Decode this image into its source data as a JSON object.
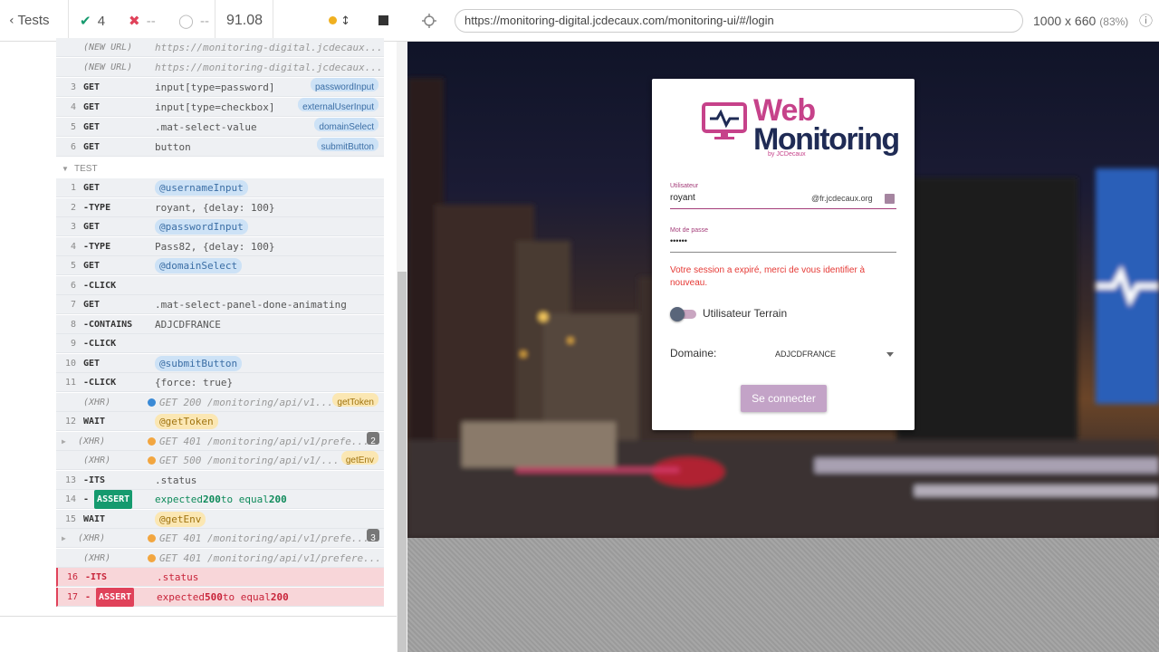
{
  "reporter": {
    "tests_label": "Tests",
    "passed": "4",
    "failed": "--",
    "pending": "--",
    "duration": "91.08",
    "commands_before": [
      {
        "num": "",
        "name": "(NEW URL)",
        "msg": "https://monitoring-digital.jcdecaux...",
        "italic": true
      },
      {
        "num": "",
        "name": "(NEW URL)",
        "msg": "https://monitoring-digital.jcdecaux...",
        "italic": true
      },
      {
        "num": "3",
        "name": "GET",
        "msg": "input[type=password]",
        "alias": "passwordInput"
      },
      {
        "num": "4",
        "name": "GET",
        "msg": "input[type=checkbox]",
        "alias": "externalUserInput"
      },
      {
        "num": "5",
        "name": "GET",
        "msg": ".mat-select-value",
        "alias": "domainSelect"
      },
      {
        "num": "6",
        "name": "GET",
        "msg": "button",
        "alias": "submitButton"
      }
    ],
    "test_label": "TEST",
    "commands": [
      {
        "num": "1",
        "name": "GET",
        "msg": "@usernameInput"
      },
      {
        "num": "2",
        "name": "-TYPE",
        "msg": "royant, {delay: 100}"
      },
      {
        "num": "3",
        "name": "GET",
        "msg": "@passwordInput"
      },
      {
        "num": "4",
        "name": "-TYPE",
        "msg": "Pass82, {delay: 100}"
      },
      {
        "num": "5",
        "name": "GET",
        "msg": "@domainSelect"
      },
      {
        "num": "6",
        "name": "-CLICK",
        "msg": ""
      },
      {
        "num": "7",
        "name": "GET",
        "msg": ".mat-select-panel-done-animating"
      },
      {
        "num": "8",
        "name": "-CONTAINS",
        "msg": "ADJCDFRANCE"
      },
      {
        "num": "9",
        "name": "-CLICK",
        "msg": ""
      },
      {
        "num": "10",
        "name": "GET",
        "msg": "@submitButton"
      },
      {
        "num": "11",
        "name": "-CLICK",
        "msg": "{force: true}"
      },
      {
        "num": "",
        "name": "(XHR)",
        "msg": "GET 200 /monitoring/api/v1...",
        "alias": "getToken"
      },
      {
        "num": "12",
        "name": "WAIT",
        "msg": "@getToken"
      },
      {
        "num": "",
        "name": "(XHR)",
        "msg": "GET 401 /monitoring/api/v1/prefe...",
        "count": "2"
      },
      {
        "num": "",
        "name": "(XHR)",
        "msg": "GET 500 /monitoring/api/v1/...",
        "alias": "getEnv"
      },
      {
        "num": "13",
        "name": "-ITS",
        "msg": ".status"
      },
      {
        "num": "14",
        "name": "-ASSERT",
        "assert_parts": [
          "expected",
          "200",
          "to equal",
          "200"
        ]
      },
      {
        "num": "15",
        "name": "WAIT",
        "msg": "@getEnv"
      },
      {
        "num": "",
        "name": "(XHR)",
        "msg": "GET 401 /monitoring/api/v1/prefe...",
        "count": "3"
      },
      {
        "num": "",
        "name": "(XHR)",
        "msg": "GET 401 /monitoring/api/v1/prefere..."
      },
      {
        "num": "16",
        "name": "-ITS",
        "msg": ".status"
      },
      {
        "num": "17",
        "name": "-ASSERT",
        "assert_parts": [
          "expected",
          "500",
          "to equal",
          "200"
        ]
      }
    ]
  },
  "aut": {
    "url": "https://monitoring-digital.jcdecaux.com/monitoring-ui/#/login",
    "viewport": "1000 x 660",
    "scale": "(83%)"
  },
  "login": {
    "logo_web": "Web",
    "logo_monitoring": "Monitoring",
    "logo_by": "by JCDecaux",
    "user_label": "Utilisateur",
    "user_value": "royant",
    "user_suffix": "@fr.jcdecaux.org",
    "password_label": "Mot de passe",
    "password_value": "••••••",
    "error": "Votre session a expiré, merci de vous identifier à nouveau.",
    "toggle_label": "Utilisateur Terrain",
    "domain_label": "Domaine:",
    "domain_value": "ADJCDFRANCE",
    "submit_label": "Se connecter"
  },
  "colors": {
    "pass": "#159a6e",
    "fail": "#e0425a",
    "brand_pink": "#c6428a",
    "brand_navy": "#1f2b55",
    "error": "#e53935"
  },
  "icons": [
    "chevron-left-icon",
    "check-icon",
    "cross-icon",
    "spinner-icon",
    "status-dot-icon",
    "scroll-arrows-icon",
    "stop-icon",
    "crosshair-icon",
    "more-icon",
    "person-card-icon",
    "monitor-pulse-icon"
  ]
}
